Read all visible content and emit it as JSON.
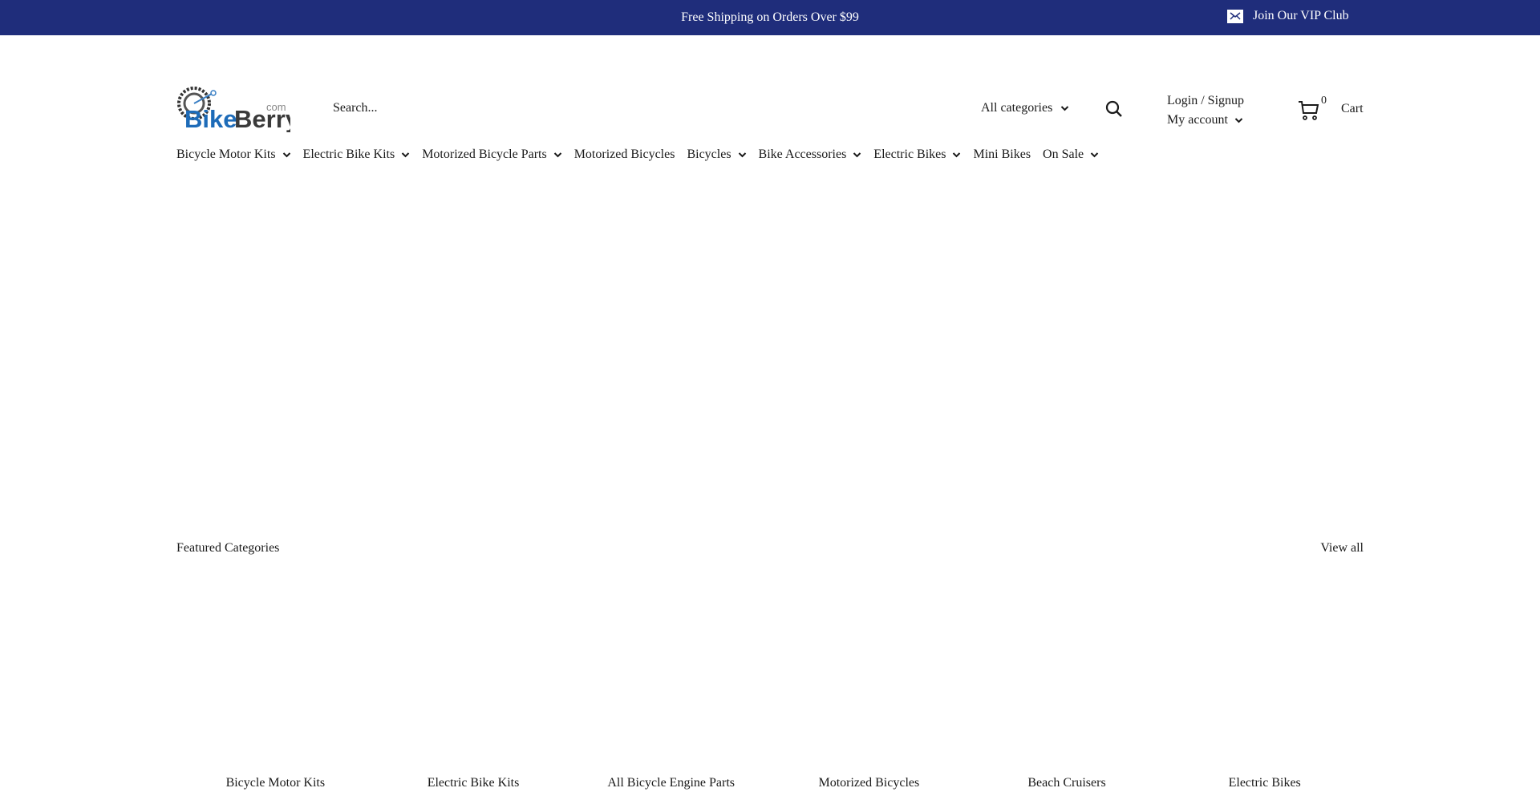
{
  "announcement": {
    "message": "Free Shipping on Orders Over $99",
    "vip_label": "Join Our VIP Club",
    "vip_icon": "mail-icon",
    "bg_color": "#1f2d7b"
  },
  "header": {
    "logo_alt": "BikeBerry.com",
    "logo_text": "BikeBerry",
    "logo_suffix": ".com",
    "search": {
      "placeholder": "Search...",
      "value": ""
    },
    "category_select": {
      "selected": "All categories"
    },
    "search_icon": "search-icon",
    "account": {
      "login_label": "Login / Signup",
      "my_account_label": "My account"
    },
    "cart": {
      "count": "0",
      "label": "Cart",
      "icon": "cart-icon"
    }
  },
  "nav": {
    "items": [
      {
        "label": "Bicycle Motor Kits",
        "has_dropdown": true
      },
      {
        "label": "Electric Bike Kits",
        "has_dropdown": true
      },
      {
        "label": "Motorized Bicycle Parts",
        "has_dropdown": true
      },
      {
        "label": "Motorized Bicycles",
        "has_dropdown": false
      },
      {
        "label": "Bicycles",
        "has_dropdown": true
      },
      {
        "label": "Bike Accessories",
        "has_dropdown": true
      },
      {
        "label": "Electric Bikes",
        "has_dropdown": true
      },
      {
        "label": "Mini Bikes",
        "has_dropdown": false
      },
      {
        "label": "On Sale",
        "has_dropdown": true
      }
    ]
  },
  "featured": {
    "title": "Featured Categories",
    "view_all": "View all",
    "categories": [
      {
        "label": "Bicycle Motor Kits"
      },
      {
        "label": "Electric Bike Kits"
      },
      {
        "label": "All Bicycle Engine Parts"
      },
      {
        "label": "Motorized Bicycles"
      },
      {
        "label": "Beach Cruisers"
      },
      {
        "label": "Electric Bikes"
      }
    ]
  }
}
